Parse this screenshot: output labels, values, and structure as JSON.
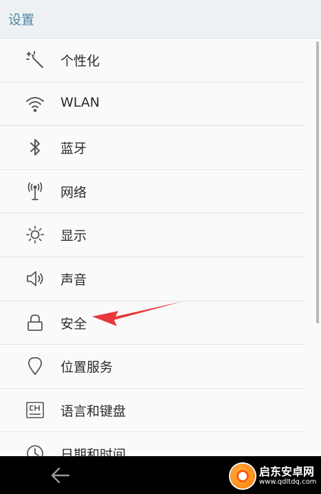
{
  "header": {
    "title": "设置"
  },
  "items": [
    {
      "label": "个性化",
      "icon": "magic-wand-icon"
    },
    {
      "label": "WLAN",
      "icon": "wifi-icon"
    },
    {
      "label": "蓝牙",
      "icon": "bluetooth-icon"
    },
    {
      "label": "网络",
      "icon": "antenna-icon"
    },
    {
      "label": "显示",
      "icon": "brightness-icon"
    },
    {
      "label": "声音",
      "icon": "speaker-icon"
    },
    {
      "label": "安全",
      "icon": "lock-icon"
    },
    {
      "label": "位置服务",
      "icon": "location-pin-icon"
    },
    {
      "label": "语言和键盘",
      "icon": "language-keyboard-icon"
    },
    {
      "label": "日期和时间",
      "icon": "clock-icon"
    }
  ],
  "watermark": {
    "brand": "启东安卓网",
    "url": "www.qdltdq.com"
  },
  "colors": {
    "title": "#4d87a8",
    "arrow": "#e8383d",
    "icon": "#555555"
  }
}
